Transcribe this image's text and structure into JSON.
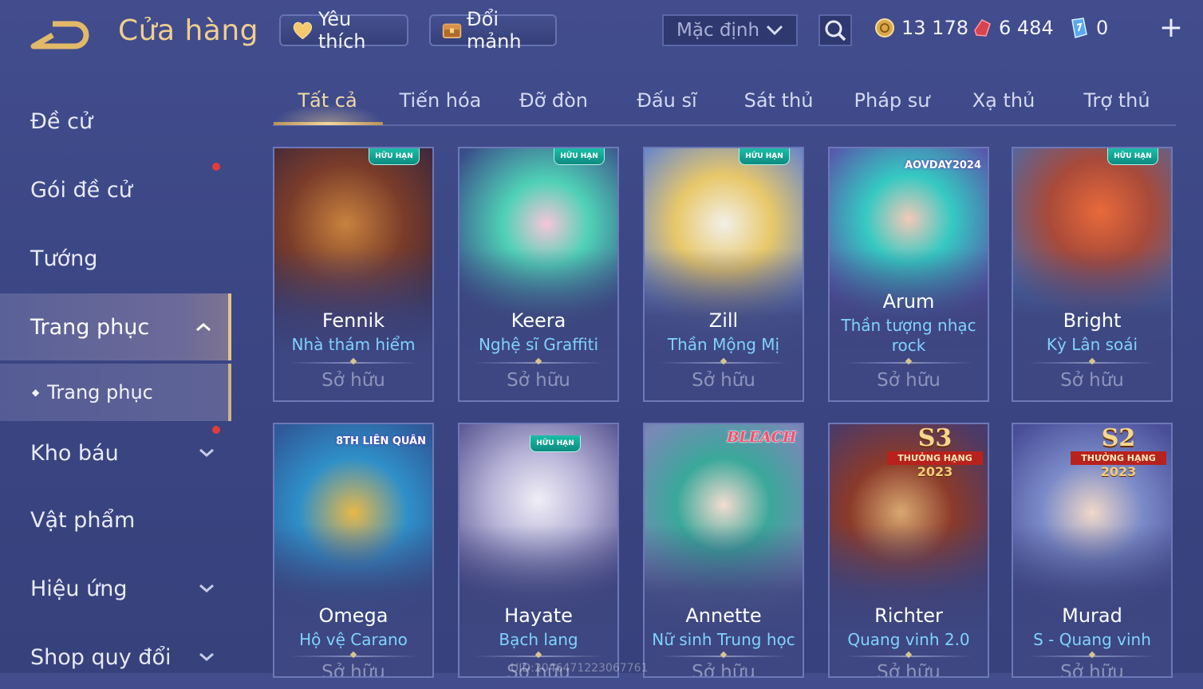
{
  "header": {
    "title": "Cửa hàng",
    "favorites_label": "Yêu thích",
    "exchange_label": "Đổi mảnh",
    "sort_value": "Mặc định",
    "currencies": [
      {
        "icon": "gold-coin-icon",
        "value": "13 178"
      },
      {
        "icon": "red-voucher-icon",
        "value": "6 484"
      },
      {
        "icon": "blue-gem-icon",
        "value": "0"
      }
    ]
  },
  "sidebar": {
    "items": [
      {
        "label": "Đề cử"
      },
      {
        "label": "Gói đề cử"
      },
      {
        "label": "Tướng"
      },
      {
        "label": "Trang phục"
      },
      {
        "label": "Kho báu"
      },
      {
        "label": "Vật phẩm"
      },
      {
        "label": "Hiệu ứng"
      },
      {
        "label": "Shop quy đổi"
      }
    ],
    "sub_item": "Trang phục"
  },
  "tabs": [
    "Tất cả",
    "Tiến hóa",
    "Đỡ đòn",
    "Đấu sĩ",
    "Sát thủ",
    "Pháp sư",
    "Xạ thủ",
    "Trợ thủ"
  ],
  "cards": [
    {
      "hero": "Fennik",
      "skin": "Nhà thám hiểm",
      "status": "Sở hữu"
    },
    {
      "hero": "Keera",
      "skin": "Nghệ sĩ Graffiti",
      "status": "Sở hữu"
    },
    {
      "hero": "Zill",
      "skin": "Thần Mộng Mị",
      "status": "Sở hữu"
    },
    {
      "hero": "Arum",
      "skin": "Thần tượng nhạc rock",
      "status": "Sở hữu"
    },
    {
      "hero": "Bright",
      "skin": "Kỳ Lân soái",
      "status": "Sở hữu"
    },
    {
      "hero": "Omega",
      "skin": "Hộ vệ Carano",
      "status": "Sở hữu"
    },
    {
      "hero": "Hayate",
      "skin": "Bạch lang",
      "status": "Sở hữu"
    },
    {
      "hero": "Annette",
      "skin": "Nữ sinh Trung học",
      "status": "Sở hữu"
    },
    {
      "hero": "Richter",
      "skin": "Quang vinh 2.0",
      "status": "Sở hữu"
    },
    {
      "hero": "Murad",
      "skin": "S - Quang vinh",
      "status": "Sở hữu"
    }
  ],
  "badges": {
    "limited": "HỮU HẠN",
    "aov_day": "AOVDAY2024",
    "lien_quan": "8TH LIÊN QUÂN",
    "bleach": "BLEACH",
    "s3": "S3",
    "s2": "S2",
    "rank_text": "THƯỞNG HẠNG",
    "rank_year": "2023"
  },
  "footer_id": "UID:2046471223067761"
}
